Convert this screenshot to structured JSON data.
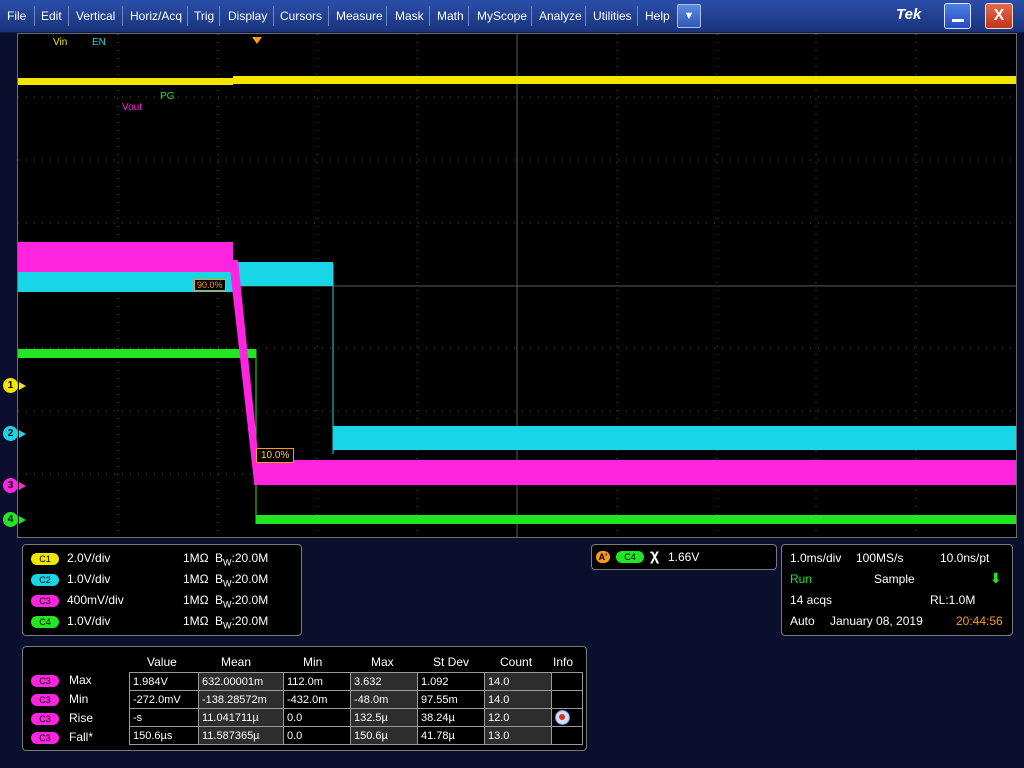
{
  "menu": {
    "items": [
      "File",
      "Edit",
      "Vertical",
      "Horiz/Acq",
      "Trig",
      "Display",
      "Cursors",
      "Measure",
      "Mask",
      "Math",
      "MyScope",
      "Analyze",
      "Utilities",
      "Help"
    ],
    "dropdown_glyph": "▼",
    "logo": "Tek",
    "close_glyph": "X"
  },
  "traces": {
    "vin_label": "Vin",
    "en_label": "EN",
    "pg_label": "PG",
    "vout_label": "Vout",
    "ref_90": "90.0%",
    "ref_10": "10.0%",
    "colors": {
      "ch1": "#f2e600",
      "ch2": "#19d6e6",
      "ch3": "#ff24e0",
      "ch4": "#22e622",
      "accent": "#ff9a1a"
    }
  },
  "channel_markers": [
    "1",
    "2",
    "3",
    "4"
  ],
  "channels": [
    {
      "badge": "C1",
      "scale": "2.0V/div",
      "impedance": "1MΩ",
      "bw_prefix": "B",
      "bw_sub": "W",
      "bw_value": ":20.0M"
    },
    {
      "badge": "C2",
      "scale": "1.0V/div",
      "impedance": "1MΩ",
      "bw_prefix": "B",
      "bw_sub": "W",
      "bw_value": ":20.0M"
    },
    {
      "badge": "C3",
      "scale": "400mV/div",
      "impedance": "1MΩ",
      "bw_prefix": "B",
      "bw_sub": "W",
      "bw_value": ":20.0M"
    },
    {
      "badge": "C4",
      "scale": "1.0V/div",
      "impedance": "1MΩ",
      "bw_prefix": "B",
      "bw_sub": "W",
      "bw_value": ":20.0M"
    }
  ],
  "trigger": {
    "mode": "A'",
    "source": "C4",
    "slope_glyph": "χ",
    "level": "1.66V"
  },
  "acquisition": {
    "timebase": "1.0ms/div",
    "sample_rate": "100MS/s",
    "resolution": "10.0ns/pt",
    "state": "Run",
    "mode": "Sample",
    "acqs": "14 acqs",
    "record_length": "RL:1.0M",
    "trigger_mode": "Auto",
    "date": "January 08, 2019",
    "time": "20:44:56"
  },
  "measurements": {
    "headers": [
      "Value",
      "Mean",
      "Min",
      "Max",
      "St Dev",
      "Count",
      "Info"
    ],
    "rows": [
      {
        "badge": "C3",
        "name": "Max",
        "value": "1.984V",
        "mean": "632.00001m",
        "min": "112.0m",
        "max": "3.632",
        "stdev": "1.092",
        "count": "14.0",
        "info": ""
      },
      {
        "badge": "C3",
        "name": "Min",
        "value": "-272.0mV",
        "mean": "-138.28572m",
        "min": "-432.0m",
        "max": "-48.0m",
        "stdev": "97.55m",
        "count": "14.0",
        "info": ""
      },
      {
        "badge": "C3",
        "name": "Rise",
        "value": "-s",
        "mean": "11.041711µ",
        "min": "0.0",
        "max": "132.5µ",
        "stdev": "38.24µ",
        "count": "12.0",
        "info": "info-icon"
      },
      {
        "badge": "C3",
        "name": "Fall*",
        "value": "150.6µs",
        "mean": "11.587365µ",
        "min": "0.0",
        "max": "150.6µ",
        "stdev": "41.78µ",
        "count": "13.0",
        "info": ""
      }
    ]
  }
}
